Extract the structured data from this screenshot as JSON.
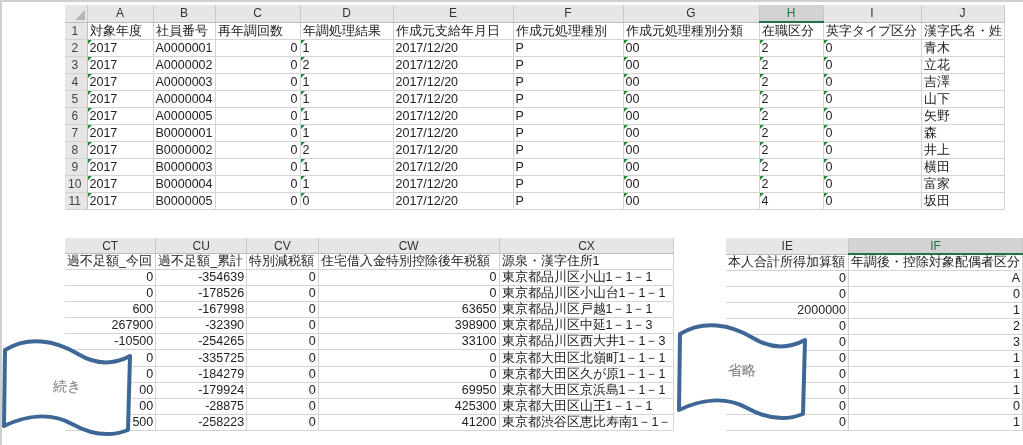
{
  "sheets": [
    {
      "row_numbers": true,
      "columns": [
        {
          "letter": "A",
          "kind": "text",
          "marker": true,
          "selected": false
        },
        {
          "letter": "B",
          "kind": "text",
          "marker": false,
          "selected": false
        },
        {
          "letter": "C",
          "kind": "number",
          "marker": false,
          "selected": false
        },
        {
          "letter": "D",
          "kind": "text",
          "marker": true,
          "selected": false
        },
        {
          "letter": "E",
          "kind": "text",
          "marker": false,
          "selected": false
        },
        {
          "letter": "F",
          "kind": "text",
          "marker": false,
          "selected": false
        },
        {
          "letter": "G",
          "kind": "text",
          "marker": true,
          "selected": false
        },
        {
          "letter": "H",
          "kind": "text",
          "marker": true,
          "selected": true
        },
        {
          "letter": "I",
          "kind": "text",
          "marker": true,
          "selected": false
        },
        {
          "letter": "J",
          "kind": "text",
          "marker": false,
          "selected": false
        }
      ],
      "rows": [
        {
          "number": "1",
          "header": true,
          "cells": [
            "対象年度",
            "社員番号",
            "再年調回数",
            "年調処理結果",
            "作成元支給年月日",
            "作成元処理種別",
            "作成元処理種別分類",
            "在職区分",
            "英字タイプ区分",
            "漢字氏名・姓"
          ]
        },
        {
          "number": "2",
          "header": false,
          "cells": [
            "2017",
            "A0000001",
            "0",
            "1",
            "2017/12/20",
            "P",
            "00",
            "2",
            "0",
            "青木"
          ]
        },
        {
          "number": "3",
          "header": false,
          "cells": [
            "2017",
            "A0000002",
            "0",
            "2",
            "2017/12/20",
            "P",
            "00",
            "2",
            "0",
            "立花"
          ]
        },
        {
          "number": "4",
          "header": false,
          "cells": [
            "2017",
            "A0000003",
            "0",
            "1",
            "2017/12/20",
            "P",
            "00",
            "2",
            "0",
            "吉澤"
          ]
        },
        {
          "number": "5",
          "header": false,
          "cells": [
            "2017",
            "A0000004",
            "0",
            "1",
            "2017/12/20",
            "P",
            "00",
            "2",
            "0",
            "山下"
          ]
        },
        {
          "number": "6",
          "header": false,
          "cells": [
            "2017",
            "A0000005",
            "0",
            "1",
            "2017/12/20",
            "P",
            "00",
            "2",
            "0",
            "矢野"
          ]
        },
        {
          "number": "7",
          "header": false,
          "cells": [
            "2017",
            "B0000001",
            "0",
            "1",
            "2017/12/20",
            "P",
            "00",
            "2",
            "0",
            "森"
          ]
        },
        {
          "number": "8",
          "header": false,
          "cells": [
            "2017",
            "B0000002",
            "0",
            "2",
            "2017/12/20",
            "P",
            "00",
            "2",
            "0",
            "井上"
          ]
        },
        {
          "number": "9",
          "header": false,
          "cells": [
            "2017",
            "B0000003",
            "0",
            "1",
            "2017/12/20",
            "P",
            "00",
            "2",
            "0",
            "横田"
          ]
        },
        {
          "number": "10",
          "header": false,
          "cells": [
            "2017",
            "B0000004",
            "0",
            "1",
            "2017/12/20",
            "P",
            "00",
            "2",
            "0",
            "富家"
          ]
        },
        {
          "number": "11",
          "header": false,
          "cells": [
            "2017",
            "B0000005",
            "0",
            "0",
            "2017/12/20",
            "P",
            "00",
            "4",
            "0",
            "坂田"
          ]
        }
      ]
    },
    {
      "row_numbers": false,
      "columns": [
        {
          "letter": "CT",
          "kind": "number",
          "marker": false,
          "selected": false
        },
        {
          "letter": "CU",
          "kind": "number",
          "marker": false,
          "selected": false
        },
        {
          "letter": "CV",
          "kind": "number",
          "marker": false,
          "selected": false
        },
        {
          "letter": "CW",
          "kind": "number",
          "marker": false,
          "selected": false
        },
        {
          "letter": "CX",
          "kind": "text",
          "marker": false,
          "selected": false
        }
      ],
      "rows": [
        {
          "header": true,
          "cells": [
            "過不足額_今回",
            "過不足額_累計",
            "特別減税額",
            "住宅借入金特別控除後年税額",
            "源泉・漢字住所1"
          ]
        },
        {
          "header": false,
          "cells": [
            "0",
            "-354639",
            "0",
            "0",
            "東京都品川区小山1－1－1"
          ]
        },
        {
          "header": false,
          "cells": [
            "0",
            "-178526",
            "0",
            "0",
            "東京都品川区小山台1－1－1"
          ]
        },
        {
          "header": false,
          "cells": [
            "600",
            "-167998",
            "0",
            "63650",
            "東京都品川区戸越1－1－1"
          ]
        },
        {
          "header": false,
          "cells": [
            "267900",
            "-32390",
            "0",
            "398900",
            "東京都品川区中延1－1－3"
          ]
        },
        {
          "header": false,
          "cells": [
            "-10500",
            "-254265",
            "0",
            "33100",
            "東京都品川区西大井1－1－3"
          ]
        },
        {
          "header": false,
          "cells": [
            "0",
            "-335725",
            "0",
            "0",
            "東京都大田区北嶺町1－1－1"
          ]
        },
        {
          "header": false,
          "cells": [
            "0",
            "-184279",
            "0",
            "0",
            "東京都大田区久が原1－1－1"
          ]
        },
        {
          "header": false,
          "cells": [
            "00",
            "-179924",
            "0",
            "69950",
            "東京都大田区京浜島1－1－1"
          ]
        },
        {
          "header": false,
          "cells": [
            "00",
            "-28875",
            "0",
            "425300",
            "東京都大田区山王1－1－1"
          ]
        },
        {
          "header": false,
          "cells": [
            "500",
            "-258223",
            "0",
            "41200",
            "東京都渋谷区恵比寿南1－1－"
          ]
        }
      ]
    },
    {
      "row_numbers": false,
      "columns": [
        {
          "letter": "IE",
          "kind": "number",
          "marker": false,
          "selected": false
        },
        {
          "letter": "IF",
          "kind": "number",
          "marker": false,
          "selected": true
        }
      ],
      "rows": [
        {
          "header": true,
          "cells": [
            "本人合計所得加算額",
            "年調後・控除対象配偶者区分"
          ]
        },
        {
          "header": false,
          "cells": [
            "0",
            "A"
          ]
        },
        {
          "header": false,
          "cells": [
            "0",
            "0"
          ]
        },
        {
          "header": false,
          "cells": [
            "2000000",
            "1"
          ]
        },
        {
          "header": false,
          "cells": [
            "0",
            "2"
          ]
        },
        {
          "header": false,
          "cells": [
            "0",
            "3"
          ]
        },
        {
          "header": false,
          "cells": [
            "0",
            "1"
          ]
        },
        {
          "header": false,
          "cells": [
            "0",
            "1"
          ]
        },
        {
          "header": false,
          "cells": [
            "0",
            "1"
          ]
        },
        {
          "header": false,
          "cells": [
            "0",
            "0"
          ]
        },
        {
          "header": false,
          "cells": [
            "0",
            "1"
          ]
        }
      ]
    }
  ],
  "banners": [
    {
      "label": "続き"
    },
    {
      "label": "省略"
    }
  ]
}
